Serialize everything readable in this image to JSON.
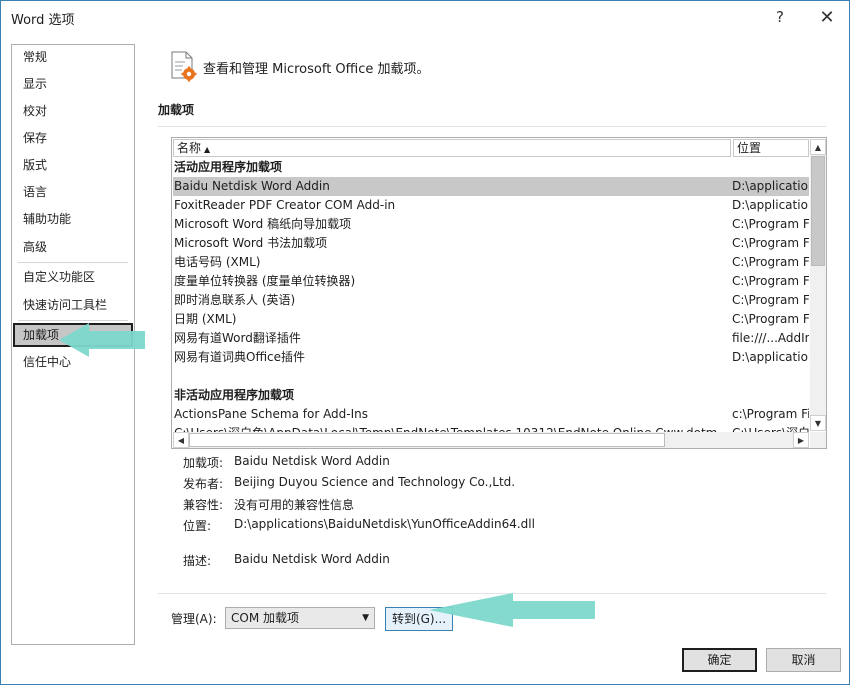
{
  "window": {
    "title": "Word 选项",
    "help": "?",
    "close": "✕"
  },
  "sidebar": {
    "items": [
      {
        "label": "常规"
      },
      {
        "label": "显示"
      },
      {
        "label": "校对"
      },
      {
        "label": "保存"
      },
      {
        "label": "版式"
      },
      {
        "label": "语言"
      },
      {
        "label": "辅助功能"
      },
      {
        "label": "高级"
      },
      {
        "label": "自定义功能区"
      },
      {
        "label": "快速访问工具栏"
      },
      {
        "label": "加载项",
        "selected": true
      },
      {
        "label": "信任中心"
      }
    ]
  },
  "header": {
    "text": "查看和管理 Microsoft Office 加载项。"
  },
  "section": {
    "title": "加载项"
  },
  "table": {
    "col_name": "名称",
    "col_location": "位置",
    "rows": [
      {
        "type": "group",
        "name": "活动应用程序加载项",
        "location": ""
      },
      {
        "type": "item",
        "name": "Baidu Netdisk Word Addin",
        "location": "D:\\applications",
        "selected": true
      },
      {
        "type": "item",
        "name": "FoxitReader PDF Creator COM Add-in",
        "location": "D:\\applications"
      },
      {
        "type": "item",
        "name": "Microsoft Word 稿纸向导加载项",
        "location": "C:\\Program Files"
      },
      {
        "type": "item",
        "name": "Microsoft Word 书法加载项",
        "location": "C:\\Program Files"
      },
      {
        "type": "item",
        "name": "电话号码 (XML)",
        "location": "C:\\Program Files"
      },
      {
        "type": "item",
        "name": "度量单位转换器 (度量单位转换器)",
        "location": "C:\\Program Files"
      },
      {
        "type": "item",
        "name": "即时消息联系人 (英语)",
        "location": "C:\\Program Files"
      },
      {
        "type": "item",
        "name": "日期 (XML)",
        "location": "C:\\Program Files"
      },
      {
        "type": "item",
        "name": "网易有道Word翻译插件",
        "location": "file:///...AddIn"
      },
      {
        "type": "item",
        "name": "网易有道词典Office插件",
        "location": "D:\\applications"
      },
      {
        "type": "blank",
        "name": "",
        "location": ""
      },
      {
        "type": "group",
        "name": "非活动应用程序加载项",
        "location": ""
      },
      {
        "type": "item",
        "name": "ActionsPane Schema for Add-Ins",
        "location": "c:\\Program Files"
      },
      {
        "type": "item",
        "name": "C:\\Users\\深白色\\AppData\\Local\\Temp\\EndNote\\Templates.10312\\EndNote Online Cww.dotm",
        "location": "C:\\Users\\深白"
      }
    ]
  },
  "details": {
    "addin_label": "加载项:",
    "addin_value": "Baidu Netdisk Word Addin",
    "publisher_label": "发布者:",
    "publisher_value": "Beijing Duyou Science and Technology Co.,Ltd.",
    "compat_label": "兼容性:",
    "compat_value": "没有可用的兼容性信息",
    "location_label": "位置:",
    "location_value": "D:\\applications\\BaiduNetdisk\\YunOfficeAddin64.dll",
    "desc_label": "描述:",
    "desc_value": "Baidu Netdisk Word Addin"
  },
  "footer": {
    "manage_label": "管理(A):",
    "manage_selected": "COM 加载项",
    "goto_label": "转到(G)...",
    "ok_label": "确定",
    "cancel_label": "取消"
  },
  "colors": {
    "accent": "#3c7fb1",
    "callout": "#7dd8cc",
    "selected_row": "#c8c8c8",
    "icon_gear": "#e8741e"
  }
}
